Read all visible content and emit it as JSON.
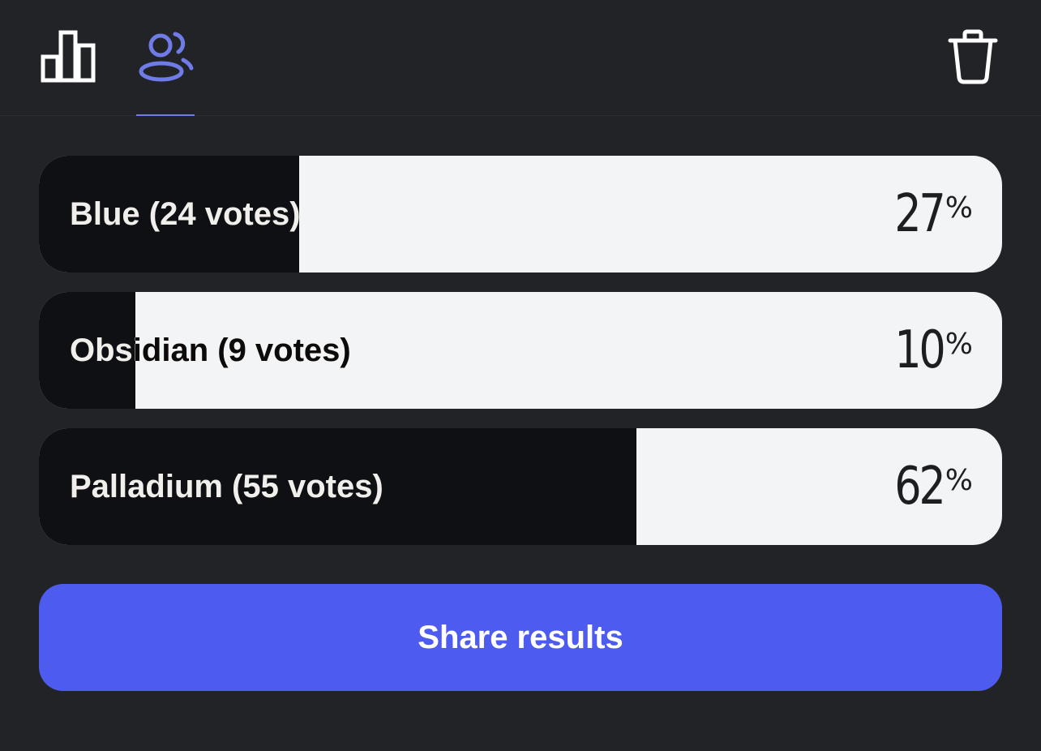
{
  "toolbar": {
    "tabs": [
      {
        "icon": "bar-chart-icon",
        "active": false
      },
      {
        "icon": "voters-icon",
        "active": true
      }
    ],
    "delete_icon": "trash-icon"
  },
  "poll": {
    "options": [
      {
        "label": "Blue (24 votes)",
        "percent_value": 27,
        "percent": "27",
        "percent_sign": "%"
      },
      {
        "label": "Obsidian (9 votes)",
        "percent_value": 10,
        "percent": "10",
        "percent_sign": "%"
      },
      {
        "label": "Palladium (55 votes)",
        "percent_value": 62,
        "percent": "62",
        "percent_sign": "%"
      }
    ]
  },
  "actions": {
    "share_label": "Share results"
  },
  "colors": {
    "background": "#222327",
    "bar_fill": "#0e1014",
    "bar_track": "#f3f4f6",
    "accent": "#4e5bef",
    "active_tab": "#6f7ce8"
  }
}
